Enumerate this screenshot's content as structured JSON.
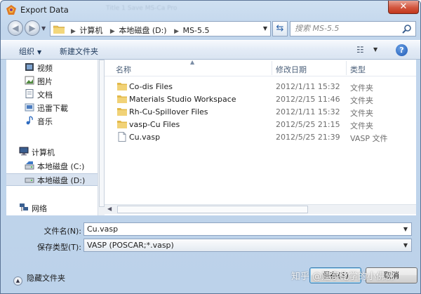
{
  "window": {
    "title": "Export Data",
    "blurred_title_text": "Title 1 Save MS-Ca Pro"
  },
  "address": {
    "crumbs": [
      "计算机",
      "本地磁盘 (D:)",
      "MS-5.5"
    ]
  },
  "search": {
    "placeholder": "搜索 MS-5.5"
  },
  "toolbar": {
    "organize_label": "组织",
    "new_folder_label": "新建文件夹"
  },
  "sidebar": {
    "items": [
      {
        "label": "视频",
        "icon": "video-icon"
      },
      {
        "label": "图片",
        "icon": "picture-icon"
      },
      {
        "label": "文档",
        "icon": "document-icon"
      },
      {
        "label": "迅雷下載",
        "icon": "download-folder-icon"
      },
      {
        "label": "音乐",
        "icon": "music-icon"
      },
      {
        "label": "计算机",
        "icon": "computer-icon"
      },
      {
        "label": "本地磁盘 (C:)",
        "icon": "drive-c-icon"
      },
      {
        "label": "本地磁盘 (D:)",
        "icon": "drive-d-icon",
        "selected": true
      },
      {
        "label": "网络",
        "icon": "network-icon"
      }
    ]
  },
  "columns": {
    "name": "名称",
    "date": "修改日期",
    "type": "类型"
  },
  "files": [
    {
      "name": "Co-dis Files",
      "date": "2012/1/11 15:32",
      "type": "文件夹",
      "icon": "folder-icon"
    },
    {
      "name": "Materials Studio Workspace",
      "date": "2012/2/15 11:46",
      "type": "文件夹",
      "icon": "folder-icon"
    },
    {
      "name": "Rh-Cu-Spillover Files",
      "date": "2012/1/11 15:32",
      "type": "文件夹",
      "icon": "folder-icon"
    },
    {
      "name": "vasp-Cu Files",
      "date": "2012/5/25 21:15",
      "type": "文件夹",
      "icon": "folder-icon"
    },
    {
      "name": "Cu.vasp",
      "date": "2012/5/25 21:39",
      "type": "VASP 文件",
      "icon": "file-icon"
    }
  ],
  "form": {
    "filename_label": "文件名(N):",
    "filename_value": "Cu.vasp",
    "filetype_label": "保存类型(T):",
    "filetype_value": "VASP (POSCAR;*.vasp)"
  },
  "footer": {
    "hide_folders_label": "隐藏文件夹",
    "save_label": "保存(S)",
    "cancel_label": "取消"
  },
  "watermark": "知乎 @建宇化学的小佛佛"
}
